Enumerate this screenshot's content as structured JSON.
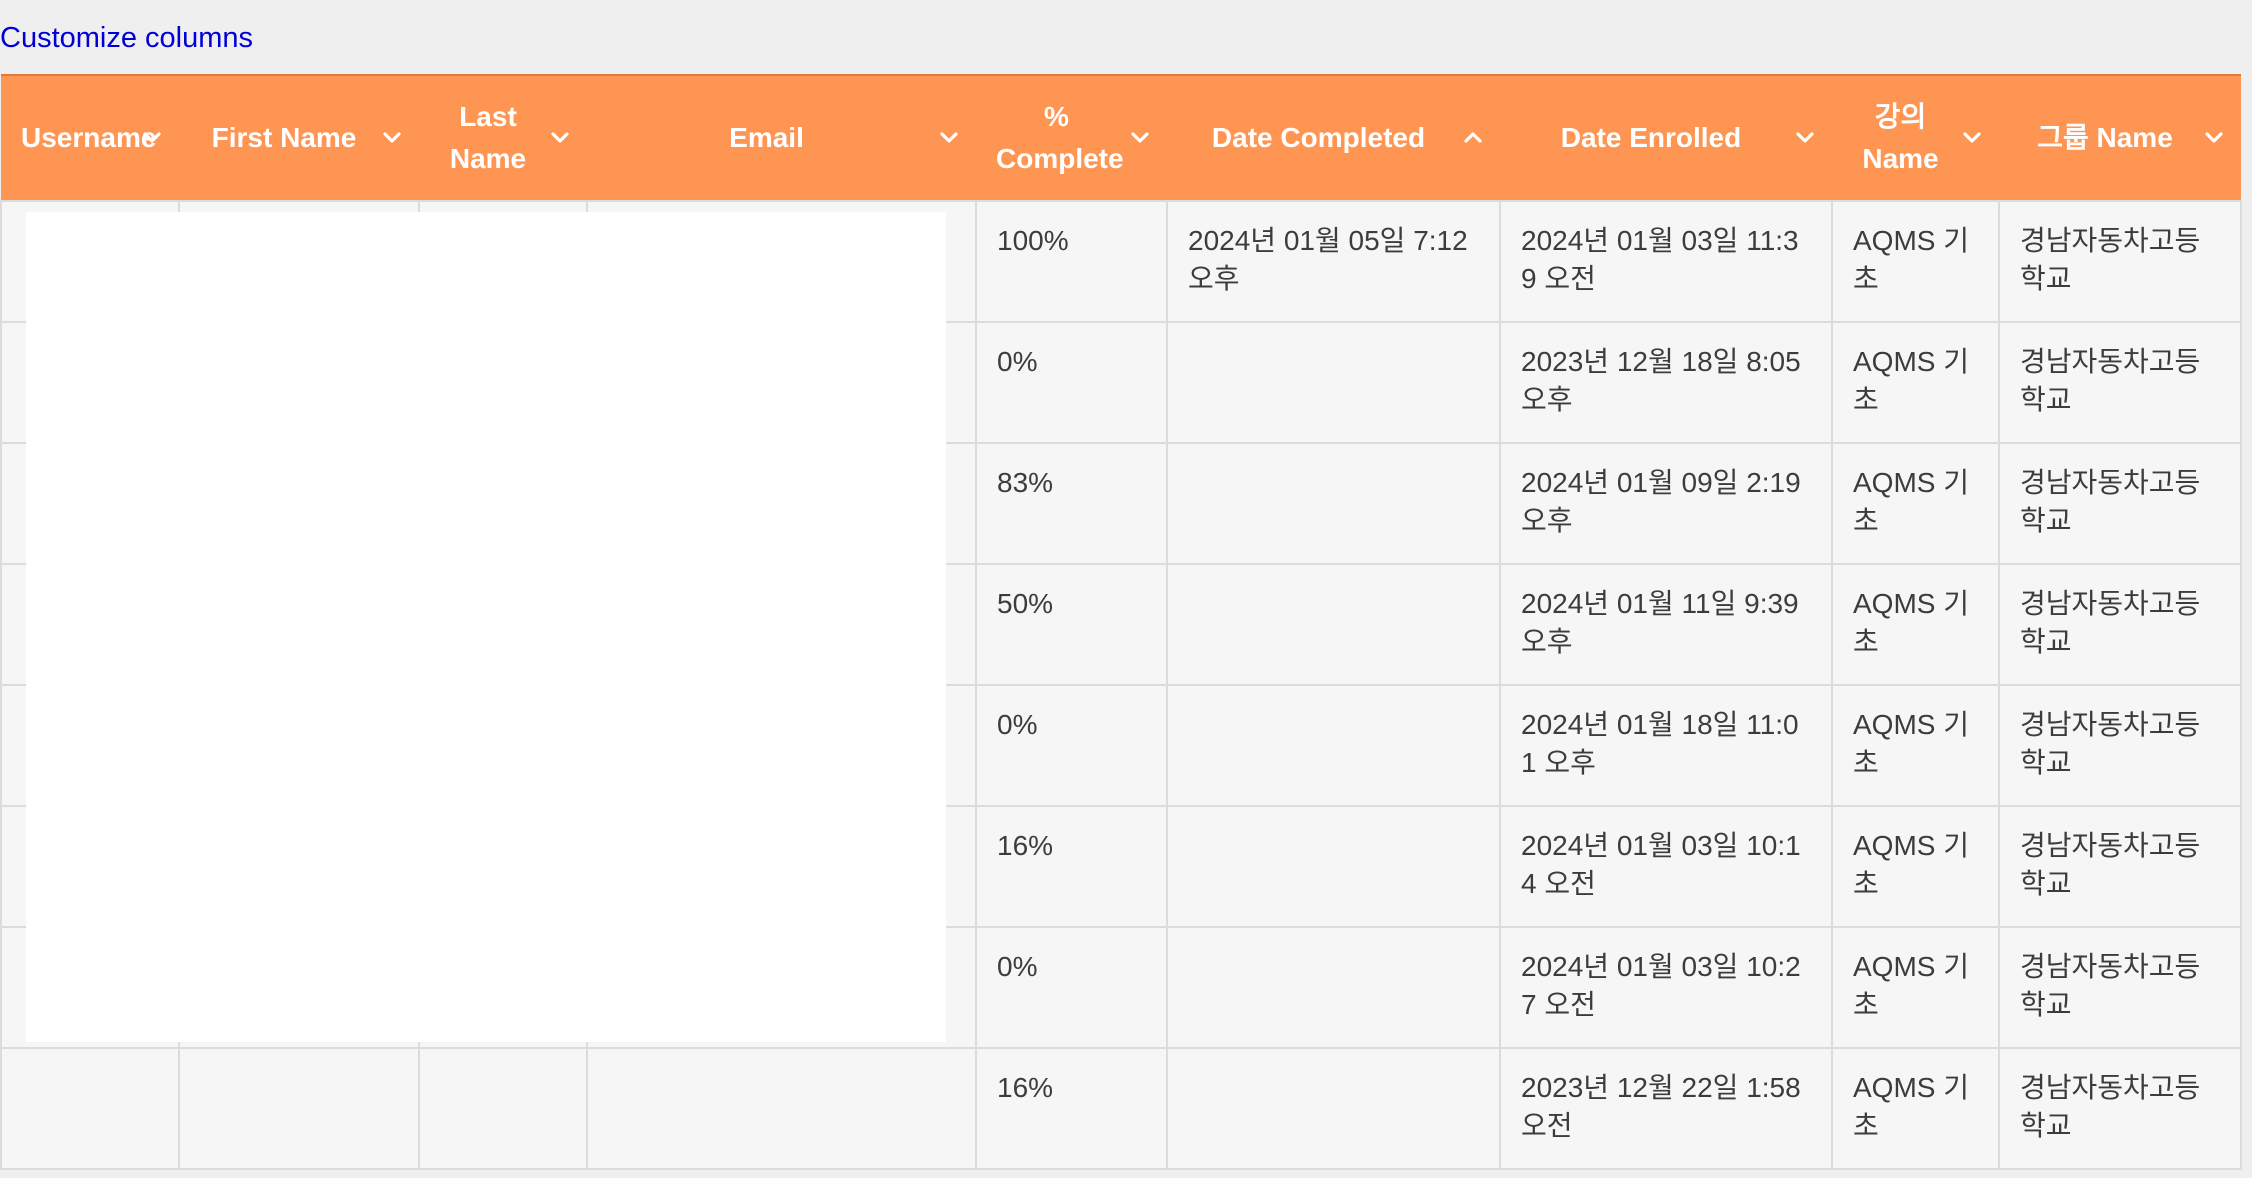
{
  "customize_link": "Customize columns",
  "columns": [
    {
      "label": "Username",
      "sort": "desc"
    },
    {
      "label": "First Name",
      "sort": "desc"
    },
    {
      "label": "Last Name",
      "sort": "desc"
    },
    {
      "label": "Email",
      "sort": "desc"
    },
    {
      "label": "% Complete",
      "sort": "desc"
    },
    {
      "label": "Date Completed",
      "sort": "asc"
    },
    {
      "label": "Date Enrolled",
      "sort": "desc"
    },
    {
      "label": "강의 Name",
      "sort": "desc"
    },
    {
      "label": "그룹 Name",
      "sort": "desc"
    }
  ],
  "rows": [
    {
      "username": "",
      "first_name": "",
      "last_name": "",
      "email": "",
      "complete": "100%",
      "date_completed": "2024년 01월 05일 7:12 오후",
      "date_enrolled": "2024년 01월 03일 11:39 오전",
      "course": "AQMS 기초",
      "group": "경남자동차고등학교"
    },
    {
      "username": "",
      "first_name": "",
      "last_name": "",
      "email": "",
      "complete": "0%",
      "date_completed": "",
      "date_enrolled": "2023년 12월 18일 8:05 오후",
      "course": "AQMS 기초",
      "group": "경남자동차고등학교"
    },
    {
      "username": "",
      "first_name": "",
      "last_name": "",
      "email": "",
      "complete": "83%",
      "date_completed": "",
      "date_enrolled": "2024년 01월 09일 2:19 오후",
      "course": "AQMS 기초",
      "group": "경남자동차고등학교"
    },
    {
      "username": "",
      "first_name": "",
      "last_name": "",
      "email": "",
      "complete": "50%",
      "date_completed": "",
      "date_enrolled": "2024년 01월 11일 9:39 오후",
      "course": "AQMS 기초",
      "group": "경남자동차고등학교"
    },
    {
      "username": "",
      "first_name": "",
      "last_name": "",
      "email": "",
      "complete": "0%",
      "date_completed": "",
      "date_enrolled": "2024년 01월 18일 11:01 오후",
      "course": "AQMS 기초",
      "group": "경남자동차고등학교"
    },
    {
      "username": "",
      "first_name": "",
      "last_name": "",
      "email": "",
      "complete": "16%",
      "date_completed": "",
      "date_enrolled": "2024년 01월 03일 10:14 오전",
      "course": "AQMS 기초",
      "group": "경남자동차고등학교"
    },
    {
      "username": "",
      "first_name": "",
      "last_name": "",
      "email": "",
      "complete": "0%",
      "date_completed": "",
      "date_enrolled": "2024년 01월 03일 10:27 오전",
      "course": "AQMS 기초",
      "group": "경남자동차고등학교"
    },
    {
      "username": "",
      "first_name": "",
      "last_name": "",
      "email": "",
      "complete": "16%",
      "date_completed": "",
      "date_enrolled": "2023년 12월 22일 1:58 오전",
      "course": "AQMS 기초",
      "group": "경남자동차고등학교"
    }
  ],
  "colors": {
    "header_bg": "#ff9552",
    "header_text": "#ffffff",
    "link": "#0000d6",
    "cell_bg": "#f6f6f6"
  }
}
